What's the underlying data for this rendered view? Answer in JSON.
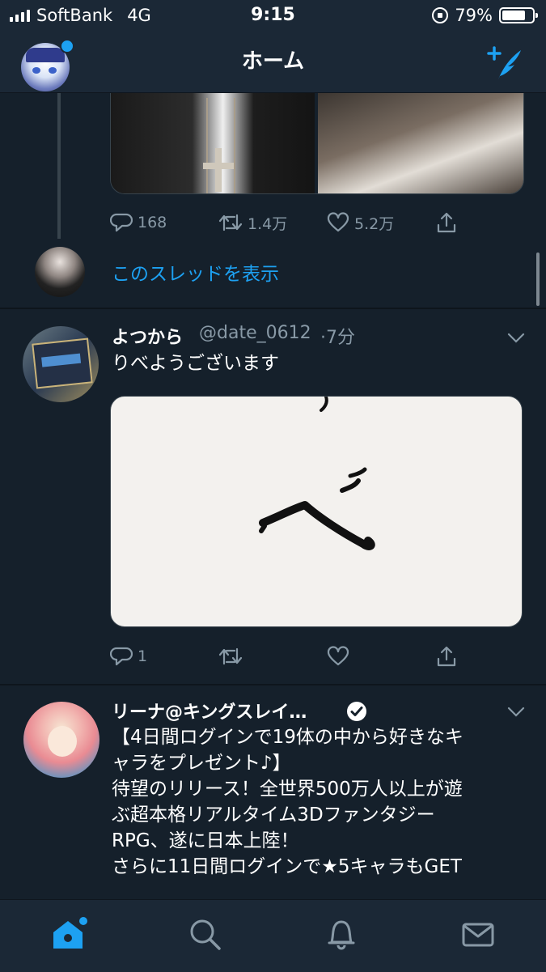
{
  "status_bar": {
    "carrier": "SoftBank",
    "network": "4G",
    "time": "9:15",
    "battery": "79%",
    "battery_level": 0.79
  },
  "nav": {
    "title": "ホーム",
    "icons": [
      "profile-avatar",
      "compose-tweet-icon"
    ]
  },
  "feed": {
    "tweet1": {
      "reply_count": "168",
      "retweet_count": "1.4万",
      "like_count": "5.2万",
      "show_thread": "このスレッドを表示"
    },
    "tweet2": {
      "name": "よつから",
      "handle": "@date_0612",
      "time": "·7分",
      "text": "りべようございます",
      "reply_count": "1"
    },
    "tweet3": {
      "name": "リーナ@キングスレイ…",
      "lines": [
        "【4日間ログインで19体の中から好きなキ",
        "ャラをプレゼント♪】",
        "待望のリリース！全世界500万人以上が遊",
        "ぶ超本格リアルタイム3Dファンタジー",
        "RPG、遂に日本上陸！",
        "さらに11日間ログインで★5キャラもGET"
      ]
    }
  },
  "tabbar": {
    "tabs": [
      "home",
      "search",
      "notifications",
      "messages"
    ],
    "active": "home"
  },
  "colors": {
    "background": "#15202b",
    "bar": "#1b2836",
    "accent": "#1da1f2",
    "muted": "#8899a6"
  }
}
